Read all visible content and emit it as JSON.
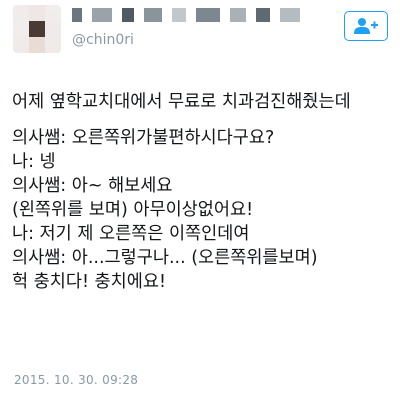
{
  "author": {
    "handle": "@chin0ri"
  },
  "follow_button": {
    "icon": "add-user-icon",
    "color": "#1da1f2"
  },
  "tweet": {
    "lines": [
      "어제 옆학교치대에서 무료로 치과검진해줬는데",
      "의사쌤: 오른쪽위가불편하시다구요?",
      "나: 넹",
      "의사쌤: 아~ 해보세요",
      "(왼쪽위를 보며) 아무이상없어요!",
      "나: 저기 제 오른쪽은 이쪽인데여",
      "의사쌤: 아...그렇구나... (오른쪽위를보며)",
      "헉 충치다! 충치에요!"
    ]
  },
  "timestamp": "2015. 10. 30. 09:28",
  "colors": {
    "text": "#14171a",
    "muted": "#8899a6",
    "accent": "#1da1f2"
  }
}
